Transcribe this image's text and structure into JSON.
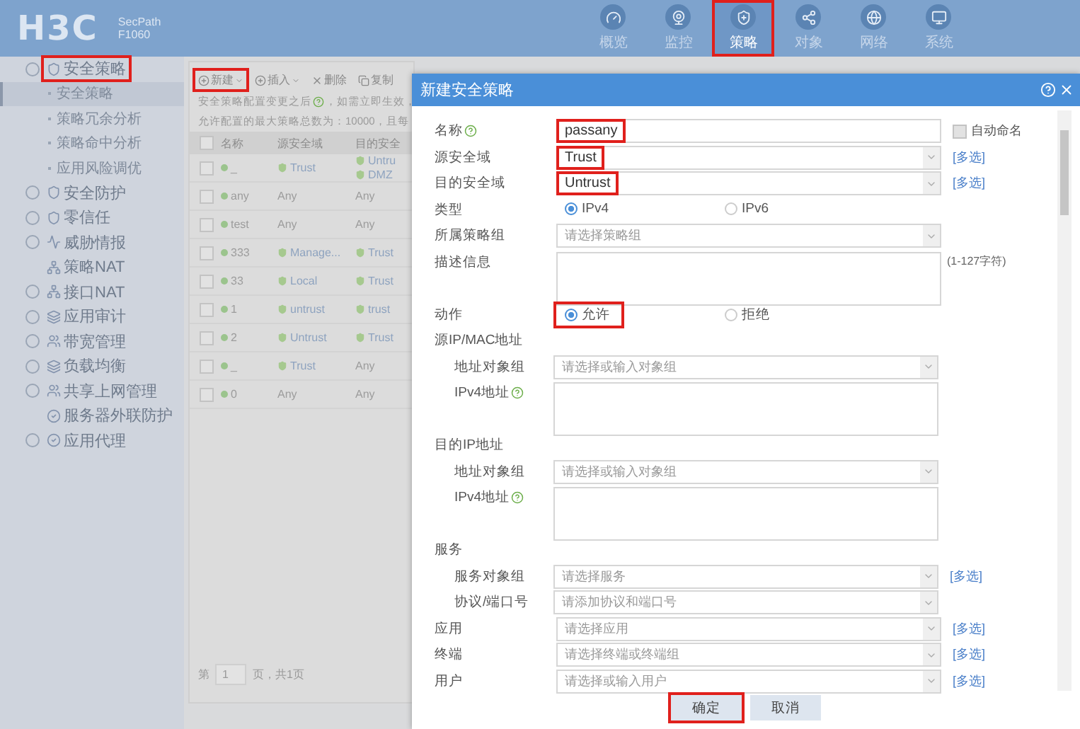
{
  "header": {
    "logo": "H3C",
    "product": "SecPath",
    "model": "F1060",
    "nav": [
      {
        "label": "概览",
        "selected": false,
        "highlighted": false
      },
      {
        "label": "监控",
        "selected": false,
        "highlighted": false
      },
      {
        "label": "策略",
        "selected": true,
        "highlighted": true
      },
      {
        "label": "对象",
        "selected": false,
        "highlighted": false
      },
      {
        "label": "网络",
        "selected": false,
        "highlighted": false
      },
      {
        "label": "系统",
        "selected": false,
        "highlighted": false
      }
    ]
  },
  "sidebar": {
    "items": [
      {
        "label": "安全策略",
        "expandable": true,
        "highlighted": true,
        "children": [
          {
            "label": "安全策略",
            "selected": true
          },
          {
            "label": "策略冗余分析",
            "selected": false
          },
          {
            "label": "策略命中分析",
            "selected": false
          },
          {
            "label": "应用风险调优",
            "selected": false
          }
        ]
      },
      {
        "label": "安全防护",
        "expandable": true,
        "highlighted": false
      },
      {
        "label": "零信任",
        "expandable": true,
        "highlighted": false
      },
      {
        "label": "威胁情报",
        "expandable": true,
        "highlighted": false
      },
      {
        "label": "策略NAT",
        "expandable": false,
        "highlighted": false
      },
      {
        "label": "接口NAT",
        "expandable": true,
        "highlighted": false
      },
      {
        "label": "应用审计",
        "expandable": true,
        "highlighted": false
      },
      {
        "label": "带宽管理",
        "expandable": true,
        "highlighted": false
      },
      {
        "label": "负载均衡",
        "expandable": true,
        "highlighted": false
      },
      {
        "label": "共享上网管理",
        "expandable": true,
        "highlighted": false
      },
      {
        "label": "服务器外联防护",
        "expandable": false,
        "highlighted": false
      },
      {
        "label": "应用代理",
        "expandable": true,
        "highlighted": false
      }
    ]
  },
  "toolbar": [
    {
      "label": "新建",
      "highlighted": true,
      "kind": "add"
    },
    {
      "label": "插入",
      "highlighted": false,
      "kind": "add"
    },
    {
      "label": "删除",
      "highlighted": false,
      "kind": "delete"
    },
    {
      "label": "复制",
      "highlighted": false,
      "kind": "copy"
    }
  ],
  "notices": [
    "安全策略配置变更之后",
    "，如需立即生效，",
    "允许配置的最大策略总数为：10000，且每"
  ],
  "table": {
    "all_checked": false,
    "columns": [
      "名称",
      "源安全域",
      "目的安全"
    ],
    "rows": [
      {
        "checked": false,
        "name": "_",
        "src": [
          {
            "text": "Trust",
            "zone": true
          }
        ],
        "dst": [
          {
            "text": "Untru",
            "zone": true
          },
          {
            "text": "DMZ",
            "zone": true
          }
        ]
      },
      {
        "checked": false,
        "name": "any",
        "src": [
          {
            "text": "Any",
            "zone": false
          }
        ],
        "dst": [
          {
            "text": "Any",
            "zone": false
          }
        ]
      },
      {
        "checked": false,
        "name": "test",
        "src": [
          {
            "text": "Any",
            "zone": false
          }
        ],
        "dst": [
          {
            "text": "Any",
            "zone": false
          }
        ]
      },
      {
        "checked": false,
        "name": "333",
        "src": [
          {
            "text": "Manage...",
            "zone": true
          }
        ],
        "dst": [
          {
            "text": "Trust",
            "zone": true
          }
        ]
      },
      {
        "checked": false,
        "name": "33",
        "src": [
          {
            "text": "Local",
            "zone": true
          }
        ],
        "dst": [
          {
            "text": "Trust",
            "zone": true
          }
        ]
      },
      {
        "checked": false,
        "name": "1",
        "src": [
          {
            "text": "untrust",
            "zone": true
          }
        ],
        "dst": [
          {
            "text": "trust",
            "zone": true
          }
        ]
      },
      {
        "checked": false,
        "name": "2",
        "src": [
          {
            "text": "Untrust",
            "zone": true
          }
        ],
        "dst": [
          {
            "text": "Trust",
            "zone": true
          }
        ]
      },
      {
        "checked": false,
        "name": "_",
        "src": [
          {
            "text": "Trust",
            "zone": true
          }
        ],
        "dst": [
          {
            "text": "Any",
            "zone": false
          }
        ]
      },
      {
        "checked": false,
        "name": "0",
        "src": [
          {
            "text": "Any",
            "zone": false
          }
        ],
        "dst": [
          {
            "text": "Any",
            "zone": false
          }
        ]
      }
    ]
  },
  "pager": {
    "before": "第",
    "page": "1",
    "after": "页，共1页"
  },
  "dialog": {
    "title": "新建安全策略",
    "fields": [
      {
        "kind": "text",
        "label": "名称",
        "help": true,
        "value": "passany",
        "highlighted": true,
        "checkbox": {
          "label": "自动命名",
          "checked": false
        }
      },
      {
        "kind": "select",
        "label": "源安全域",
        "value": "Trust",
        "highlighted": true,
        "link": "[多选]"
      },
      {
        "kind": "select",
        "label": "目的安全域",
        "value": "Untrust",
        "highlighted": true,
        "link": "[多选]"
      },
      {
        "kind": "radio",
        "label": "类型",
        "options": [
          {
            "label": "IPv4",
            "selected": true,
            "highlighted": false
          },
          {
            "label": "IPv6",
            "selected": false,
            "highlighted": false
          }
        ]
      },
      {
        "kind": "select",
        "label": "所属策略组",
        "placeholder": "请选择策略组"
      },
      {
        "kind": "textarea",
        "label": "描述信息",
        "note": "(1-127字符)"
      },
      {
        "kind": "radio",
        "label": "动作",
        "options": [
          {
            "label": "允许",
            "selected": true,
            "highlighted": true
          },
          {
            "label": "拒绝",
            "selected": false,
            "highlighted": false
          }
        ]
      },
      {
        "kind": "section",
        "label": "源IP/MAC地址",
        "children": [
          {
            "kind": "select",
            "label": "地址对象组",
            "placeholder": "请选择或输入对象组"
          },
          {
            "kind": "textarea",
            "label": "IPv4地址",
            "help": true
          }
        ]
      },
      {
        "kind": "section",
        "label": "目的IP地址",
        "children": [
          {
            "kind": "select",
            "label": "地址对象组",
            "placeholder": "请选择或输入对象组"
          },
          {
            "kind": "textarea",
            "label": "IPv4地址",
            "help": true
          }
        ]
      },
      {
        "kind": "section",
        "label": "服务",
        "children": [
          {
            "kind": "select",
            "label": "服务对象组",
            "placeholder": "请选择服务",
            "link": "[多选]"
          },
          {
            "kind": "select",
            "label": "协议/端口号",
            "placeholder": "请添加协议和端口号"
          }
        ]
      },
      {
        "kind": "select",
        "label": "应用",
        "placeholder": "请选择应用",
        "link": "[多选]"
      },
      {
        "kind": "select",
        "label": "终端",
        "placeholder": "请选择终端或终端组",
        "link": "[多选]"
      },
      {
        "kind": "select",
        "label": "用户",
        "placeholder": "请选择或输入用户",
        "link": "[多选]"
      }
    ],
    "buttons": [
      {
        "label": "确定",
        "highlighted": true
      },
      {
        "label": "取消",
        "highlighted": false
      }
    ]
  }
}
